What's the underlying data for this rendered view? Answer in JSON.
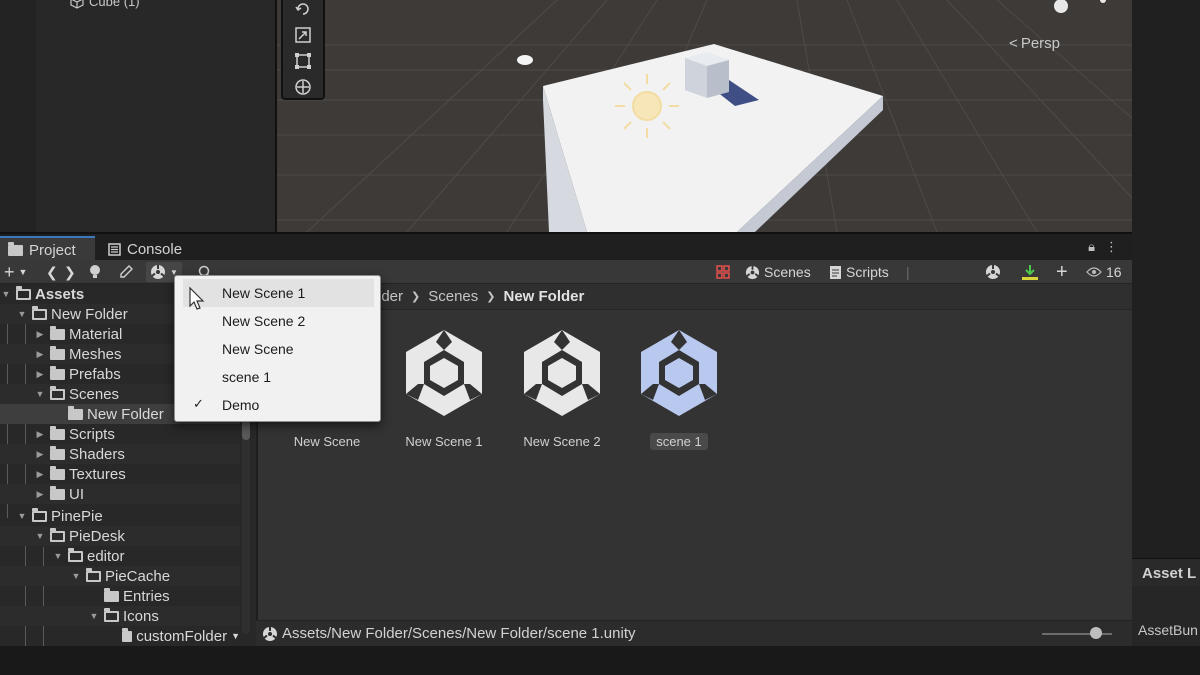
{
  "hierarchy": {
    "item_label": "Cube (1)"
  },
  "scene_view": {
    "projection_label": "Persp"
  },
  "tabs": [
    {
      "label": "Project"
    },
    {
      "label": "Console"
    }
  ],
  "toolbar": {
    "scenes_label": "Scenes",
    "scripts_label": "Scripts",
    "visible_count": "16"
  },
  "tree": {
    "assets": "Assets",
    "new_folder": "New Folder",
    "material": "Material",
    "meshes": "Meshes",
    "prefabs": "Prefabs",
    "scenes": "Scenes",
    "new_folder_sub": "New Folder",
    "scripts": "Scripts",
    "shaders": "Shaders",
    "textures": "Textures",
    "ui": "UI",
    "piepie": "PinePie",
    "piedesk": "PieDesk",
    "editor": "editor",
    "piecache": "PieCache",
    "entries": "Entries",
    "icons": "Icons",
    "custom_folder": "customFolder"
  },
  "breadcrumb": {
    "part1": "lder",
    "part2": "Scenes",
    "current": "New Folder"
  },
  "assets": [
    {
      "name": "New Scene"
    },
    {
      "name": "New Scene 1"
    },
    {
      "name": "New Scene 2"
    },
    {
      "name": "scene 1"
    }
  ],
  "path_bar": {
    "path": "Assets/New Folder/Scenes/New Folder/scene 1.unity"
  },
  "inspector": {
    "title": "Asset L",
    "field": "AssetBun"
  },
  "dropdown": {
    "items": [
      {
        "label": "New Scene 1",
        "checked": false
      },
      {
        "label": "New Scene 2",
        "checked": false
      },
      {
        "label": "New Scene",
        "checked": false
      },
      {
        "label": "scene 1",
        "checked": false
      },
      {
        "label": "Demo",
        "checked": true
      }
    ]
  },
  "colors": {
    "accent_tab": "#3a79bb",
    "selected_scene_icon": "#b9c8ee",
    "scene_icon": "#e8e8e8",
    "sun": "#f3dca2"
  }
}
